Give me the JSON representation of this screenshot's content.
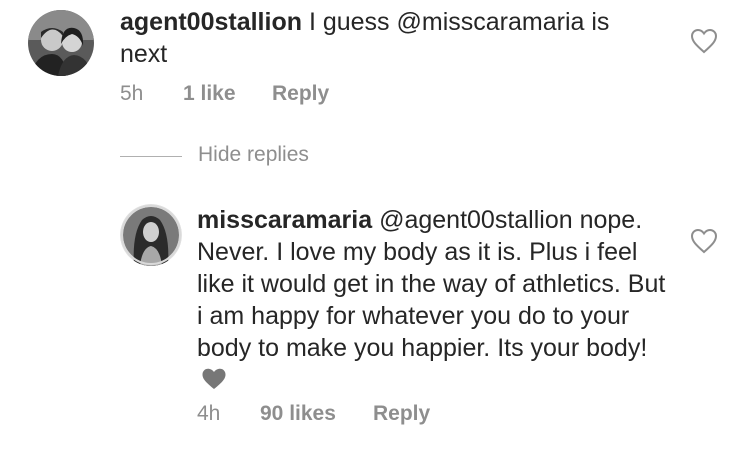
{
  "comment1": {
    "username": "agent00stallion",
    "text": " I guess @misscaramaria is next",
    "time": "5h",
    "likes": "1 like",
    "reply": "Reply",
    "avatar_icon": "avatar-photo-couple"
  },
  "hide_replies": "Hide replies",
  "comment2": {
    "username": "misscaramaria",
    "text": " @agent00stallion nope. Never. I love my body as it is. Plus i feel like it would get in the way of athletics. But i am happy for whatever you do to your body to make you happier. Its your body!",
    "emoji": "grey-heart-emoji",
    "time": "4h",
    "likes": "90 likes",
    "reply": "Reply",
    "avatar_icon": "avatar-photo-woman"
  },
  "like_icon": "heart-outline-icon",
  "colors": {
    "text": "#262626",
    "muted": "#8e8e8e",
    "background": "#ffffff"
  }
}
